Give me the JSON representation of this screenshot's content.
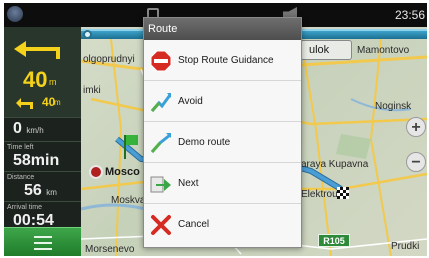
{
  "status_bar": {
    "time": "23:56",
    "icons": [
      "compass-icon",
      "sim-card-icon",
      "muted-speaker-icon"
    ]
  },
  "map": {
    "tab_label": "ulok",
    "labels": {
      "mamontovo": "Mamontovo",
      "dolgoprudnyi": "olgoprudnyi",
      "himki": "imki",
      "noginsk": "Noginsk",
      "kupavna": "araya Kupavna",
      "moscow": "Mosco",
      "moskva": "Moskva",
      "elektrougli": "Elektrougli",
      "morsenevo": "Morsenevo",
      "prudki": "Prudki"
    },
    "road_sign": "R105",
    "route_color": "#4a9ed6",
    "highway_color": "#f2c94c",
    "zoom_in": "+",
    "zoom_out": "−"
  },
  "guidance": {
    "turn_icon": "turn-left-arrow-icon",
    "turn_distance": "40",
    "turn_distance_unit": "m",
    "next_turn_icon": "next-turn-arrow-icon",
    "next_turn_distance": "40",
    "next_turn_unit": "m",
    "speed_value": "0",
    "speed_unit": "km/h",
    "time_left_label": "Time left",
    "time_left_value": "58min",
    "distance_label": "Distance",
    "distance_value": "56",
    "distance_unit": "km",
    "arrival_label": "Arrival time",
    "arrival_value": "00:54",
    "accent_color": "#f4d21c"
  },
  "menu_button": {
    "icon": "hamburger-menu-icon"
  },
  "dialog": {
    "title": "Route",
    "items": [
      {
        "label": "Stop Route Guidance",
        "icon": "stop-sign-icon"
      },
      {
        "label": "Avoid",
        "icon": "avoid-route-icon"
      },
      {
        "label": "Demo route",
        "icon": "demo-route-icon"
      },
      {
        "label": "Next",
        "icon": "next-arrow-icon"
      },
      {
        "label": "Cancel",
        "icon": "cancel-x-icon"
      }
    ]
  }
}
